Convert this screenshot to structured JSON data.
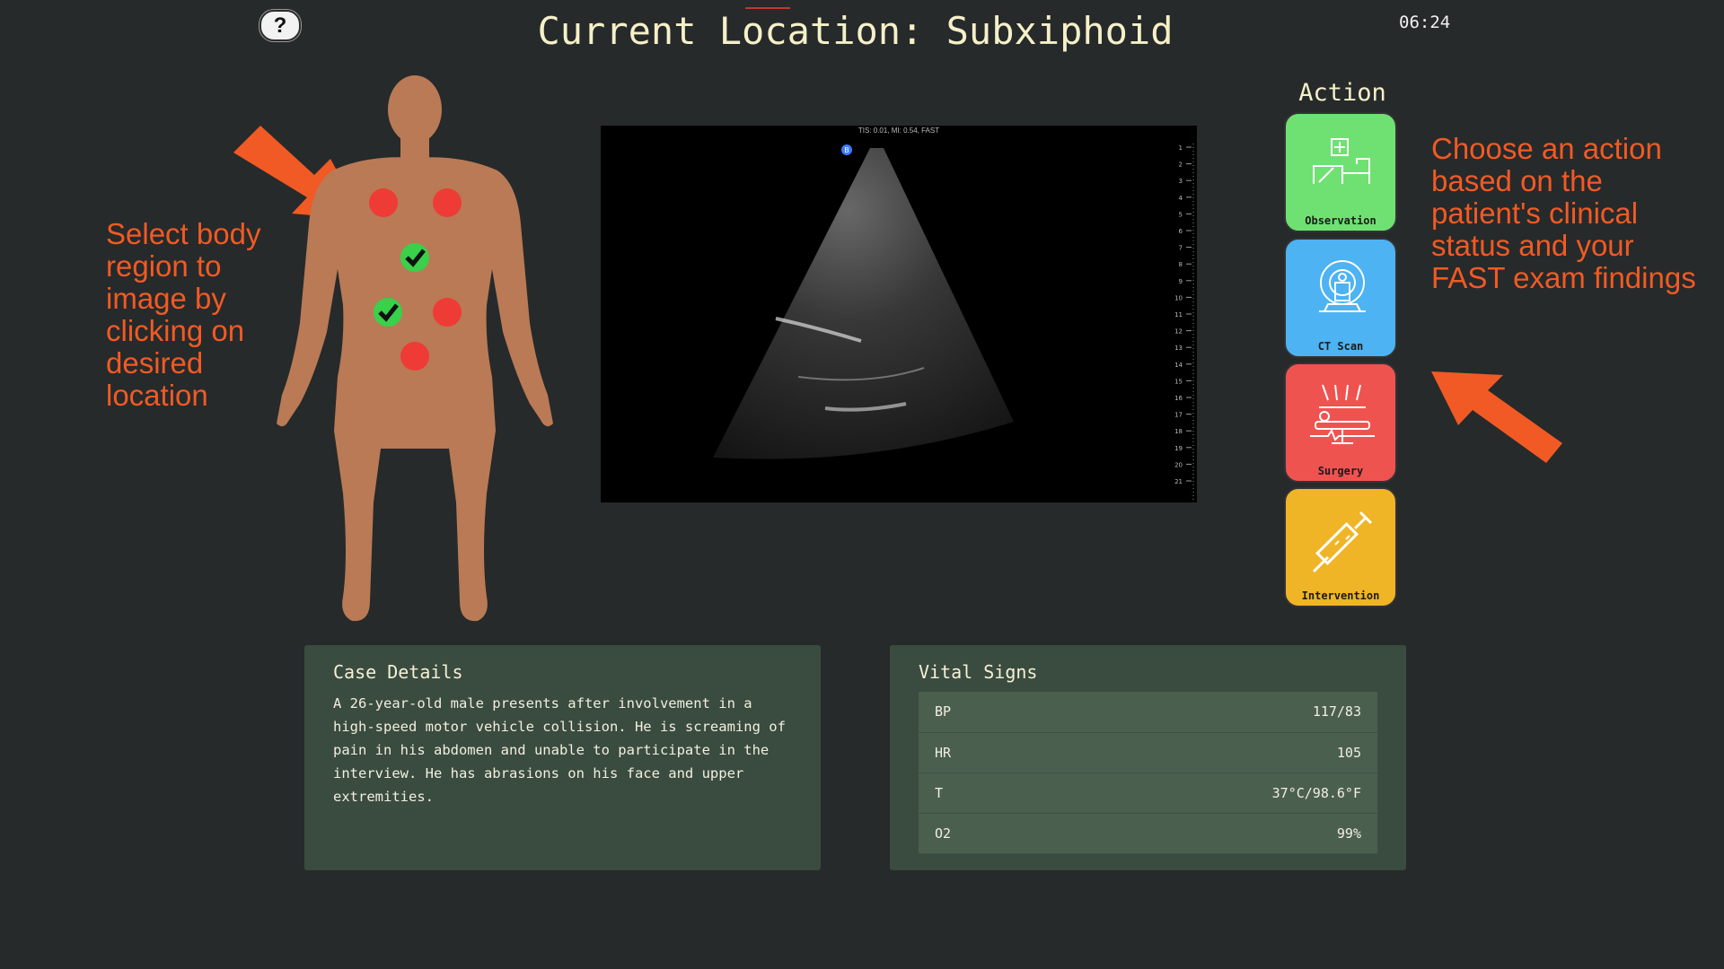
{
  "header": {
    "help_label": "?",
    "title": "Current Location: Subxiphoid",
    "timer": "06:24"
  },
  "annotations": {
    "left_text": "Select body region to image by clicking on desired location",
    "right_text": "Choose an action based on the patient's clinical status and your FAST exam findings",
    "color": "#f15a24"
  },
  "body_map": {
    "skin_color": "#b97a55",
    "regions": [
      {
        "name": "Right Upper Chest",
        "status": "unvisited",
        "color": "#ef3b36"
      },
      {
        "name": "Left Upper Chest",
        "status": "unvisited",
        "color": "#ef3b36"
      },
      {
        "name": "Subxiphoid",
        "status": "completed",
        "color": "#39d04a"
      },
      {
        "name": "RUQ",
        "status": "completed",
        "color": "#39d04a"
      },
      {
        "name": "LUQ",
        "status": "unvisited",
        "color": "#ef3b36"
      },
      {
        "name": "Pelvis",
        "status": "unvisited",
        "color": "#ef3b36"
      }
    ]
  },
  "ultrasound": {
    "header_text": "TIS: 0.01, MI: 0.54, FAST",
    "marker_label": "B",
    "depth_ticks": [
      "1",
      "2",
      "3",
      "4",
      "5",
      "6",
      "7",
      "8",
      "9",
      "10",
      "11",
      "12",
      "13",
      "14",
      "15",
      "16",
      "17",
      "18",
      "19",
      "20",
      "21"
    ]
  },
  "actions": {
    "title": "Action",
    "buttons": [
      {
        "label": "Observation",
        "icon": "hospital-bed-icon",
        "color": "#6fe172"
      },
      {
        "label": "CT Scan",
        "icon": "ct-scanner-icon",
        "color": "#4db3f2"
      },
      {
        "label": "Surgery",
        "icon": "surgery-icon",
        "color": "#ef5350"
      },
      {
        "label": "Intervention",
        "icon": "syringe-icon",
        "color": "#efb526"
      }
    ]
  },
  "case_details": {
    "title": "Case Details",
    "text": "A 26-year-old male presents after involvement in a high-speed motor vehicle collision. He is screaming of pain in his abdomen and unable to participate in the interview. He has abrasions on his face and upper extremities."
  },
  "vital_signs": {
    "title": "Vital Signs",
    "rows": [
      {
        "label": "BP",
        "value": "117/83"
      },
      {
        "label": "HR",
        "value": "105"
      },
      {
        "label": "T",
        "value": "37°C/98.6°F"
      },
      {
        "label": "O2",
        "value": "99%"
      }
    ]
  }
}
